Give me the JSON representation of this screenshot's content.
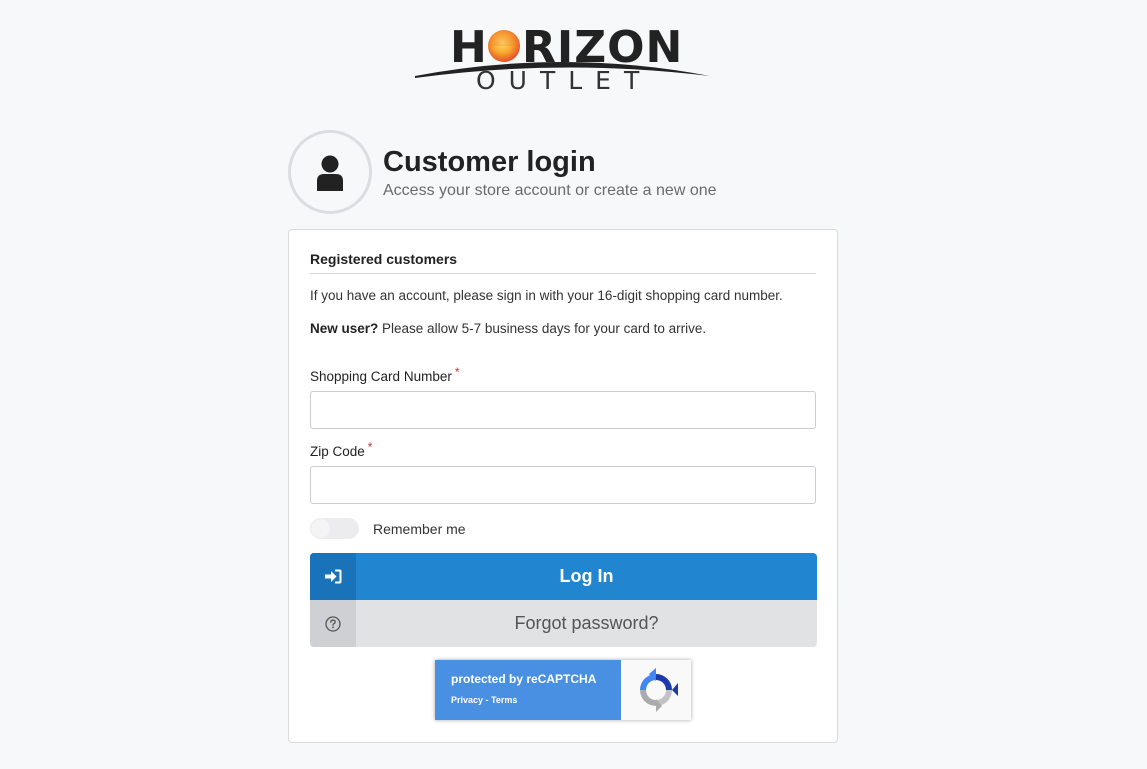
{
  "logo": {
    "main_text": "H RIZON",
    "sub_text": "OUTLET"
  },
  "header": {
    "title": "Customer login",
    "subtitle": "Access your store account or create a new one",
    "avatar_icon": "user-icon"
  },
  "card": {
    "section_title": "Registered customers",
    "info_text": "If you have an account, please sign in with your 16-digit shopping card number.",
    "new_user_bold": "New user?",
    "new_user_text": " Please allow 5-7 business days for your card to arrive."
  },
  "form": {
    "card_number": {
      "label": "Shopping Card Number",
      "required_mark": "*",
      "value": "",
      "placeholder": ""
    },
    "zip_code": {
      "label": "Zip Code",
      "required_mark": "*",
      "value": "",
      "placeholder": ""
    },
    "remember_me": {
      "label": "Remember me",
      "checked": false
    }
  },
  "buttons": {
    "login": {
      "label": "Log In",
      "icon": "sign-in-icon"
    },
    "forgot": {
      "label": "Forgot password?",
      "icon": "question-circle-icon"
    }
  },
  "recaptcha": {
    "title": "protected by reCAPTCHA",
    "privacy": "Privacy",
    "separator": " - ",
    "terms": "Terms"
  },
  "colors": {
    "primary": "#2185d0",
    "primary_dark": "#1a73b8",
    "required": "#d62c2c",
    "recaptcha_blue": "#4a90e2"
  }
}
